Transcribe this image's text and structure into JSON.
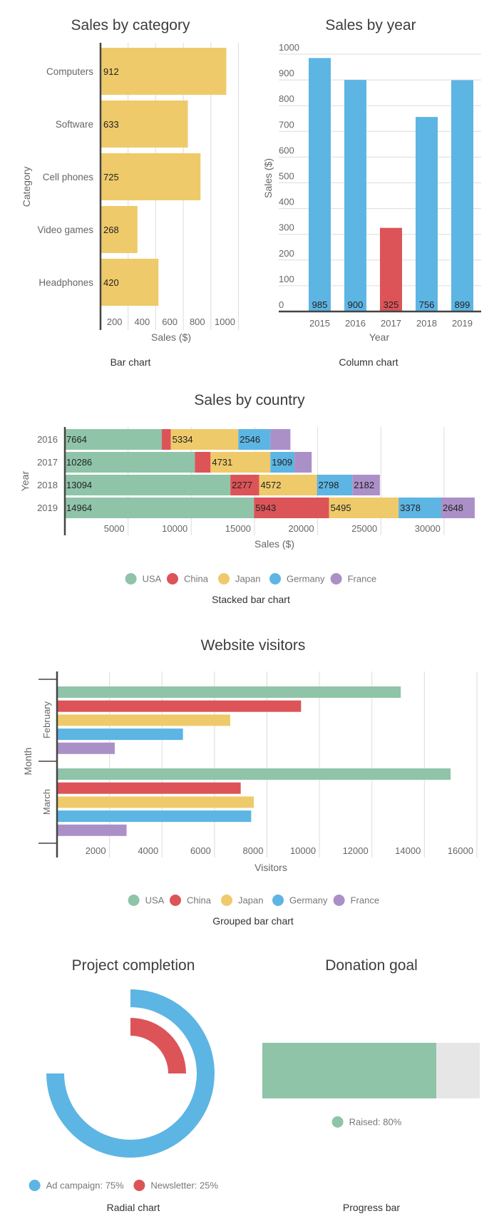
{
  "colors": {
    "yellow": "#EFCA6A",
    "blue": "#5DB5E3",
    "red": "#DC5458",
    "green": "#8FC4A8",
    "purple": "#AB90C8",
    "track": "#E6E6E6"
  },
  "chart_data": [
    {
      "id": "bar",
      "type": "bar",
      "orientation": "horizontal",
      "title": "Sales by category",
      "caption": "Bar chart",
      "xlabel": "Sales ($)",
      "ylabel": "Category",
      "categories": [
        "Computers",
        "Software",
        "Cell phones",
        "Video games",
        "Headphones"
      ],
      "values": [
        912,
        633,
        725,
        268,
        420
      ],
      "xticks": [
        200,
        400,
        600,
        800,
        1000
      ],
      "xlim": [
        0,
        1000
      ],
      "grid": true
    },
    {
      "id": "column",
      "type": "bar",
      "orientation": "vertical",
      "title": "Sales by year",
      "caption": "Column chart",
      "xlabel": "Year",
      "ylabel": "Sales ($)",
      "categories": [
        "2015",
        "2016",
        "2017",
        "2018",
        "2019"
      ],
      "values": [
        985,
        900,
        325,
        756,
        899
      ],
      "highlight": [
        "blue",
        "blue",
        "red",
        "blue",
        "blue"
      ],
      "yticks": [
        0,
        100,
        200,
        300,
        400,
        500,
        600,
        700,
        800,
        900,
        1000
      ],
      "ylim": [
        0,
        1000
      ],
      "grid": true
    },
    {
      "id": "stacked",
      "type": "bar",
      "orientation": "horizontal",
      "stacked": true,
      "title": "Sales by country",
      "caption": "Stacked bar chart",
      "xlabel": "Sales ($)",
      "ylabel": "Year",
      "categories": [
        "2016",
        "2017",
        "2018",
        "2019"
      ],
      "series": [
        {
          "name": "USA",
          "color": "green",
          "values": [
            7664,
            10286,
            13094,
            14964
          ],
          "labels": [
            "7664",
            "10286",
            "13094",
            "14964"
          ]
        },
        {
          "name": "China",
          "color": "red",
          "values": [
            720,
            1240,
            2277,
            5943
          ],
          "labels": [
            "",
            "",
            "2277",
            "5943"
          ]
        },
        {
          "name": "Japan",
          "color": "yellow",
          "values": [
            5334,
            4731,
            4572,
            5495
          ],
          "labels": [
            "5334",
            "4731",
            "4572",
            "5495"
          ]
        },
        {
          "name": "Germany",
          "color": "blue",
          "values": [
            2546,
            1909,
            2798,
            3378
          ],
          "labels": [
            "2546",
            "1909",
            "2798",
            "3378"
          ]
        },
        {
          "name": "France",
          "color": "purple",
          "values": [
            1580,
            1360,
            2182,
            2648
          ],
          "labels": [
            "",
            "",
            "2182",
            "2648"
          ]
        }
      ],
      "xticks": [
        5000,
        10000,
        15000,
        20000,
        25000,
        30000
      ],
      "xlim": [
        0,
        30000
      ],
      "legend": "bottom",
      "grid": true
    },
    {
      "id": "grouped",
      "type": "bar",
      "orientation": "horizontal",
      "grouped": true,
      "title": "Website visitors",
      "caption": "Grouped bar chart",
      "xlabel": "Visitors",
      "ylabel": "Month",
      "categories": [
        "February",
        "March"
      ],
      "series": [
        {
          "name": "USA",
          "color": "green",
          "values": [
            13100,
            15000
          ]
        },
        {
          "name": "China",
          "color": "red",
          "values": [
            9300,
            7000
          ]
        },
        {
          "name": "Japan",
          "color": "yellow",
          "values": [
            6600,
            7500
          ]
        },
        {
          "name": "Germany",
          "color": "blue",
          "values": [
            4800,
            7400
          ]
        },
        {
          "name": "France",
          "color": "purple",
          "values": [
            2200,
            2650
          ]
        }
      ],
      "xticks": [
        2000,
        4000,
        6000,
        8000,
        10000,
        12000,
        14000,
        16000
      ],
      "xlim": [
        0,
        16000
      ],
      "legend": "bottom",
      "grid": true
    },
    {
      "id": "radial",
      "type": "pie",
      "variant": "radial",
      "title": "Project completion",
      "caption": "Radial chart",
      "series": [
        {
          "name": "Ad campaign",
          "color": "blue",
          "value": 75,
          "legend_label": "Ad campaign: 75%"
        },
        {
          "name": "Newsletter",
          "color": "red",
          "value": 25,
          "legend_label": "Newsletter: 25%"
        }
      ],
      "legend": "bottom"
    },
    {
      "id": "progress",
      "type": "bar",
      "variant": "progress",
      "title": "Donation goal",
      "caption": "Progress bar",
      "value": 80,
      "max": 100,
      "legend_label": "Raised: 80%",
      "legend": "bottom"
    }
  ]
}
